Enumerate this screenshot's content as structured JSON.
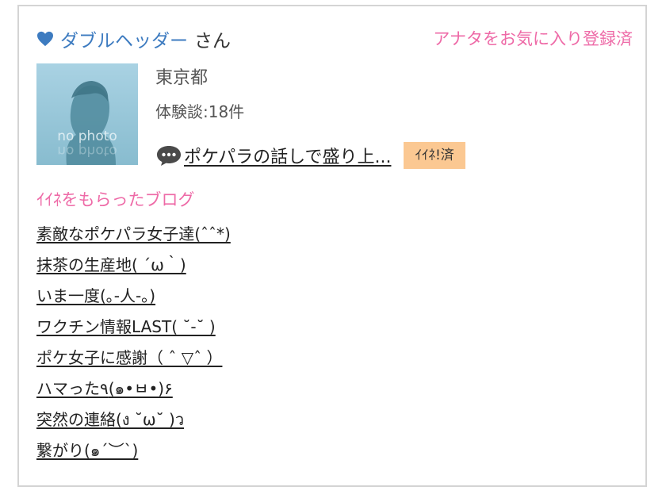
{
  "header": {
    "username": "ダブルヘッダー",
    "honorific": "さん",
    "favorite_status": "アナタをお気に入り登録済"
  },
  "profile": {
    "avatar_text": "no photo",
    "location": "東京都",
    "review_count": "体験談:18件"
  },
  "topic": {
    "title": "ポケパラの話しで盛り上...",
    "like_badge": "ｲｲﾈ!済"
  },
  "liked_blogs": {
    "heading": "ｲｲﾈをもらったブログ",
    "items": [
      "素敵なポケパラ女子達(ˆˆ*)",
      "抹茶の生産地( ´ω｀)",
      "いま一度(｡-人-｡)",
      "ワクチン情報LAST( ˘-˘ )",
      "ポケ女子に感謝（ ˆ ▽ˆ ）",
      "ハマった٩(๑•ㅂ•)۶",
      "突然の連絡(ง ˘ω˘ )ว",
      "繋がり(๑´︶`)"
    ]
  },
  "colors": {
    "username": "#3d7bc0",
    "accent_pink": "#ee6aa7",
    "badge_bg": "#fbc892",
    "border": "#d4d4d4"
  }
}
